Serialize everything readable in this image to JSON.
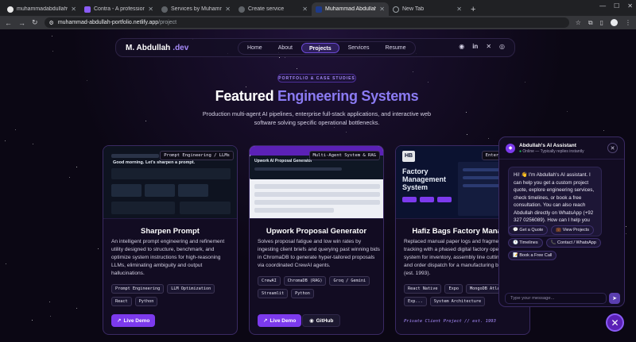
{
  "browser": {
    "tabs": [
      {
        "title": "muhammadabdullahw...",
        "icon": "github-icon",
        "active": false
      },
      {
        "title": "Contra - A professional n...",
        "icon": "contra-icon",
        "active": false
      },
      {
        "title": "Services by Muhammad...",
        "icon": "globe-icon",
        "active": false
      },
      {
        "title": "Create service",
        "icon": "globe-icon",
        "active": false
      },
      {
        "title": "Muhammad Abdullah W...",
        "icon": "site-icon",
        "active": true
      },
      {
        "title": "New Tab",
        "icon": "new-tab-icon",
        "active": false
      }
    ],
    "url_host": "muhammad-abdullah-portfolio.netlify.app",
    "url_path": "/project"
  },
  "nav": {
    "brand_name": "M. Abdullah",
    "brand_suffix": ".dev",
    "items": [
      "Home",
      "About",
      "Projects",
      "Services",
      "Resume"
    ],
    "active": "Projects"
  },
  "hero": {
    "kicker": "PORTFOLIO & CASE STUDIES",
    "title_plain": "Featured",
    "title_accent": "Engineering Systems",
    "subtitle": "Production multi-agent AI pipelines, enterprise full-stack applications, and interactive web software solving specific operational bottlenecks."
  },
  "projects": [
    {
      "title": "Sharpen Prompt",
      "tag": "Prompt Engineering / LLMs",
      "description": "An intelligent prompt engineering and refinement utility designed to structure, benchmark, and optimize system instructions for high-reasoning LLMs, eliminating ambiguity and output hallucinations.",
      "chips": [
        "Prompt Engineering",
        "LLM Optimization",
        "React",
        "Python"
      ],
      "demo_label": "Live Demo"
    },
    {
      "title": "Upwork Proposal Generator",
      "tag": "Multi-Agent System & RAG",
      "description": "Solves proposal fatigue and low win rates by ingesting client briefs and querying past winning bids in ChromaDB to generate hyper-tailored proposals via coordinated CrewAI agents.",
      "chips": [
        "CrewAI",
        "ChromaDB (RAG)",
        "Groq / Gemini",
        "Streamlit",
        "Python"
      ],
      "demo_label": "Live Demo",
      "github_label": "GitHub"
    },
    {
      "title": "Hafiz Bags Factory Manager",
      "tag": "Enterprise Sys",
      "thumb_title": "Factory Management System",
      "description": "Replaced manual paper logs and fragmented tracking with a phased digital factory operating system for inventory, assembly line cutting/stitching, and order dispatch for a manufacturing business (est. 1993).",
      "chips": [
        "React Native",
        "Expo",
        "MongoDB Atlas",
        "Exp...",
        "System Architecture"
      ],
      "footer": "Private Client Project // est. 1993"
    }
  ],
  "chat": {
    "name": "Abdullah's AI Assistant",
    "status": "Online — Typically replies instantly",
    "message": "Hi! 👋 I'm Abdullah's AI assistant. I can help you get a custom project quote, explore engineering services, check timelines, or book a free consultation. You can also reach Abdullah directly on WhatsApp (+92 327 0256089). How can I help you today?",
    "quick_replies": [
      "Get a Quote",
      "View Projects",
      "Timelines",
      "Contact / WhatsApp",
      "Book a Free Call"
    ],
    "input_placeholder": "Type your message..."
  },
  "colors": {
    "accent": "#7c3aed",
    "accent_light": "#a78bfa",
    "background": "#0b0714"
  }
}
